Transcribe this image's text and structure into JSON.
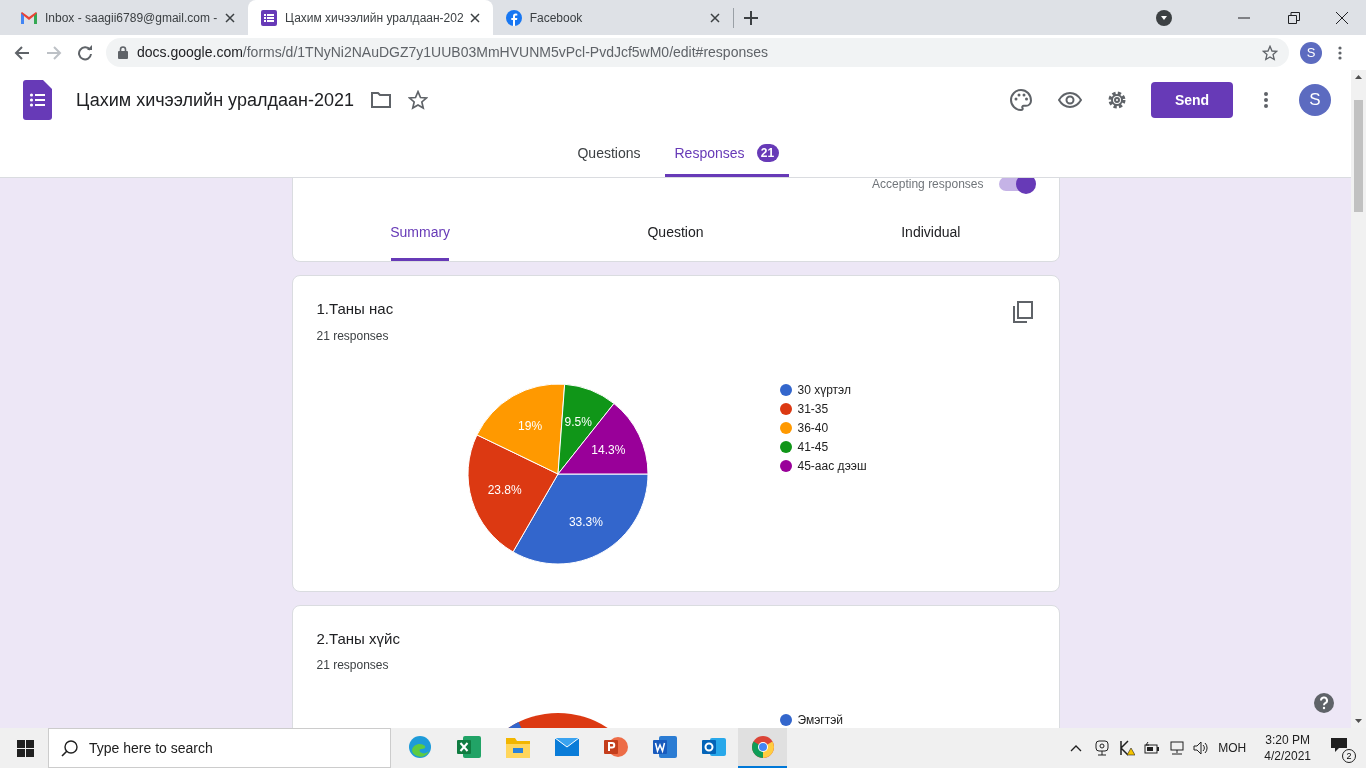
{
  "browser": {
    "tabs": [
      {
        "kind": "gmail",
        "title": "Inbox - saagii6789@gmail.com -",
        "selected": false
      },
      {
        "kind": "forms",
        "title": "Цахим хичээлийн уралдаан-202",
        "selected": true
      },
      {
        "kind": "facebook",
        "title": "Facebook",
        "selected": false
      }
    ],
    "url_host": "docs.google.com",
    "url_path": "/forms/d/1TNyNi2NAuDGZ7y1UUB03MmHVUNM5vPcl-PvdJcf5wM0/edit#responses",
    "profile": "S"
  },
  "form": {
    "title": "Цахим хичээлийн уралдаан-2021",
    "send": "Send",
    "avatar": "S",
    "nav": [
      {
        "label": "Questions",
        "selected": false
      },
      {
        "label": "Responses",
        "selected": true,
        "badge": "21"
      }
    ]
  },
  "responses": {
    "accepting_label": "Accepting responses",
    "accepting": true,
    "views": [
      {
        "label": "Summary",
        "selected": true
      },
      {
        "label": "Question",
        "selected": false
      },
      {
        "label": "Individual",
        "selected": false
      }
    ],
    "questions": [
      {
        "title": "1.Таны нас",
        "count": "21 responses",
        "chart_data": {
          "type": "pie",
          "categories": [
            "30 хүртэл",
            "31-35",
            "36-40",
            "41-45",
            "45-аас дээш"
          ],
          "values": [
            33.3,
            23.8,
            19,
            9.5,
            14.3
          ],
          "colors": [
            "#3366cc",
            "#dc3912",
            "#ff9900",
            "#109618",
            "#990099"
          ],
          "legend": "right",
          "value_labels": [
            "33.3%",
            "23.8%",
            "19%",
            "9.5%",
            "14.3%"
          ]
        }
      },
      {
        "title": "2.Таны хүйс",
        "count": "21 responses",
        "legend": [
          {
            "label": "Эмэгтэй",
            "color": "#3366cc"
          }
        ]
      }
    ]
  },
  "taskbar": {
    "search_placeholder": "Type here to search",
    "apps": [
      {
        "kind": "edge",
        "active": false
      },
      {
        "kind": "excel",
        "active": false
      },
      {
        "kind": "explorer",
        "active": false
      },
      {
        "kind": "mail",
        "active": false
      },
      {
        "kind": "powerpoint",
        "active": false
      },
      {
        "kind": "word",
        "active": false
      },
      {
        "kind": "outlook",
        "active": false
      },
      {
        "kind": "chrome",
        "active": true
      }
    ],
    "language": "МОН",
    "time": "3:20 PM",
    "date": "4/2/2021",
    "notifications": "2"
  }
}
